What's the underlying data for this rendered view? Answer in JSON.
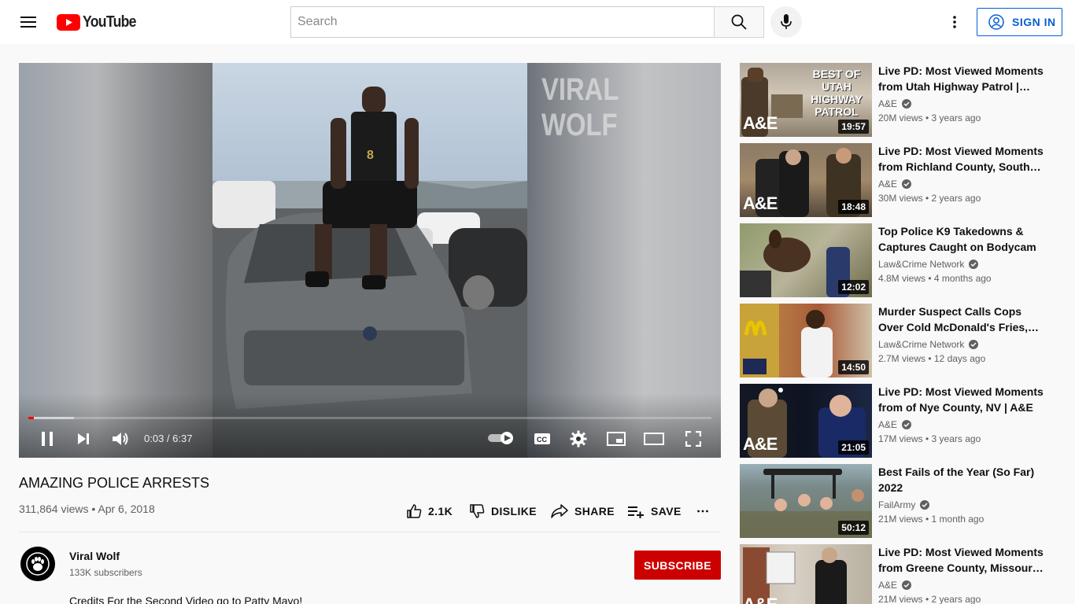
{
  "header": {
    "logo_text": "YouTube",
    "search_placeholder": "Search",
    "signin_label": "SIGN IN",
    "icons": [
      "menu-icon",
      "youtube-logo-icon",
      "search-icon",
      "mic-icon",
      "more-vert-icon",
      "account-icon"
    ]
  },
  "player": {
    "watermark": "VIRAL WOLF",
    "time_current": "0:03",
    "time_total": "6:37",
    "time_display": "0:03 / 6:37",
    "progress_played": 0.008,
    "progress_buffered": 0.067,
    "icons": [
      "pause-icon",
      "next-icon",
      "volume-icon",
      "autoplay-toggle-icon",
      "captions-icon",
      "settings-icon",
      "miniplayer-icon",
      "theater-icon",
      "fullscreen-icon"
    ]
  },
  "video": {
    "title": "AMAZING POLICE ARRESTS",
    "info": "311,864 views • Apr 6, 2018",
    "like_count": "2.1K",
    "dislike_label": "DISLIKE",
    "share_label": "SHARE",
    "save_label": "SAVE"
  },
  "channel": {
    "name": "Viral Wolf",
    "subscribers": "133K subscribers",
    "subscribe_label": "SUBSCRIBE",
    "description": "Credits For the Second Video go to Patty Mayo!"
  },
  "recommendations": [
    {
      "title": "Live PD: Most Viewed Moments from Utah Highway Patrol | A&E",
      "channel": "A&E",
      "verified": true,
      "meta": "20M views • 3 years ago",
      "duration": "19:57",
      "thumb_text": "BEST OF UTAH HIGHWAY PATROL",
      "ae": true
    },
    {
      "title": "Live PD: Most Viewed Moments from Richland County, South…",
      "channel": "A&E",
      "verified": true,
      "meta": "30M views • 2 years ago",
      "duration": "18:48",
      "ae": true
    },
    {
      "title": "Top Police K9 Takedowns & Captures Caught on Bodycam",
      "channel": "Law&Crime Network",
      "verified": true,
      "meta": "4.8M views • 4 months ago",
      "duration": "12:02",
      "ae": false
    },
    {
      "title": "Murder Suspect Calls Cops Over Cold McDonald's Fries,…",
      "channel": "Law&Crime Network",
      "verified": true,
      "meta": "2.7M views • 12 days ago",
      "duration": "14:50",
      "ae": false
    },
    {
      "title": "Live PD: Most Viewed Moments from of Nye County, NV | A&E",
      "channel": "A&E",
      "verified": true,
      "meta": "17M views • 3 years ago",
      "duration": "21:05",
      "ae": true
    },
    {
      "title": "Best Fails of the Year (So Far) 2022",
      "channel": "FailArmy",
      "verified": true,
      "meta": "21M views • 1 month ago",
      "duration": "50:12",
      "ae": false
    },
    {
      "title": "Live PD: Most Viewed Moments from Greene County, Missouri …",
      "channel": "A&E",
      "verified": true,
      "meta": "21M views • 2 years ago",
      "duration": "",
      "ae": true
    }
  ]
}
